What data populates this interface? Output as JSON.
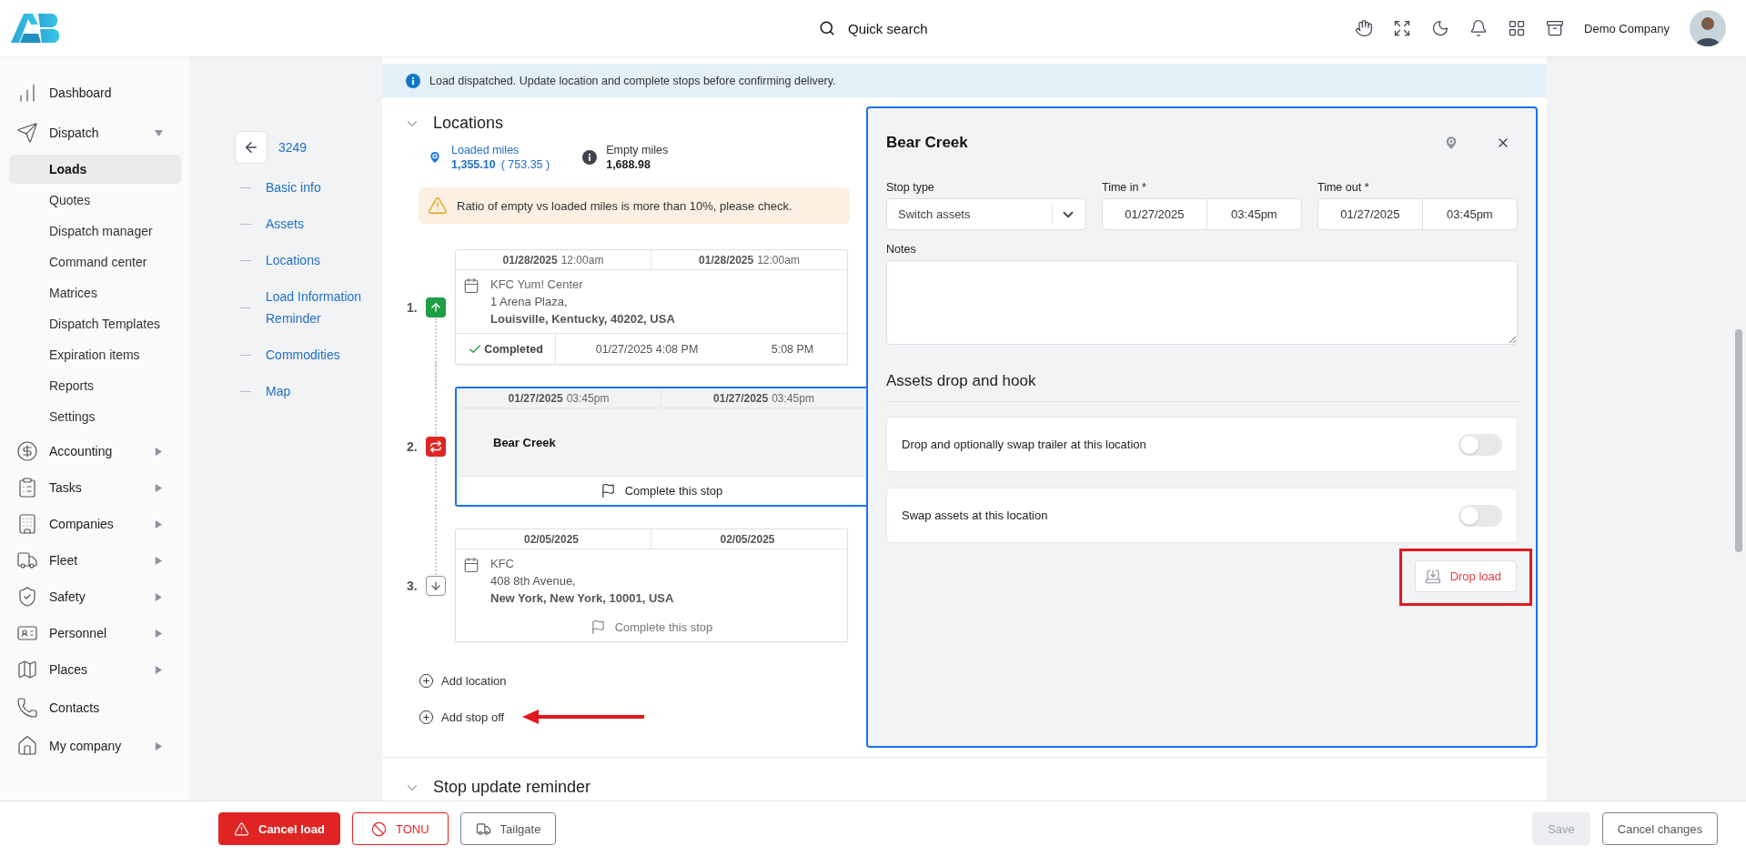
{
  "header": {
    "search_label": "Quick search",
    "company": "Demo Company"
  },
  "sidebar": {
    "items": [
      {
        "label": "Dashboard",
        "selected": false
      },
      {
        "label": "Dispatch",
        "selected": false,
        "expanded": true,
        "children": [
          {
            "label": "Loads",
            "selected": true
          },
          {
            "label": "Quotes",
            "selected": false
          },
          {
            "label": "Dispatch manager",
            "selected": false
          },
          {
            "label": "Command center",
            "selected": false
          },
          {
            "label": "Matrices",
            "selected": false
          },
          {
            "label": "Dispatch Templates",
            "selected": false
          },
          {
            "label": "Expiration items",
            "selected": false
          },
          {
            "label": "Reports",
            "selected": false
          },
          {
            "label": "Settings",
            "selected": false
          }
        ]
      },
      {
        "label": "Accounting",
        "selected": false,
        "expanded": false
      },
      {
        "label": "Tasks",
        "selected": false,
        "expanded": false
      },
      {
        "label": "Companies",
        "selected": false,
        "expanded": false
      },
      {
        "label": "Fleet",
        "selected": false,
        "expanded": false
      },
      {
        "label": "Safety",
        "selected": false,
        "expanded": false
      },
      {
        "label": "Personnel",
        "selected": false,
        "expanded": false
      },
      {
        "label": "Places",
        "selected": false,
        "expanded": false
      },
      {
        "label": "Contacts",
        "selected": false
      },
      {
        "label": "My company",
        "selected": false,
        "expanded": false
      }
    ]
  },
  "anchor_nav": {
    "load_number": "3249",
    "links": [
      {
        "label": "Basic info"
      },
      {
        "label": "Assets"
      },
      {
        "label": "Locations"
      },
      {
        "label": "Load Information Reminder"
      },
      {
        "label": "Commodities"
      },
      {
        "label": "Map"
      }
    ]
  },
  "banner": "Load dispatched. Update location and complete stops before confirming delivery.",
  "locations": {
    "title": "Locations",
    "loaded_miles": {
      "label": "Loaded miles",
      "value": "1,355.10",
      "extra": "( 753.35 )"
    },
    "empty_miles": {
      "label": "Empty miles",
      "value": "1,688.98"
    },
    "warning": "Ratio of empty vs loaded miles is more than 10%, please check.",
    "stops": [
      {
        "number": "1.",
        "kind": "pickup",
        "selected": false,
        "arrival": {
          "date": "01/28/2025",
          "time": "12:00am"
        },
        "departure": {
          "date": "01/28/2025",
          "time": "12:00am"
        },
        "name": "KFC Yum! Center",
        "street": "1 Arena Plaza,",
        "city": "Louisville, Kentucky, 40202, USA",
        "completed": true,
        "status": "Completed",
        "actual_in": "01/27/2025 4:08 PM",
        "actual_out": "5:08 PM"
      },
      {
        "number": "2.",
        "kind": "switch",
        "selected": true,
        "arrival": {
          "date": "01/27/2025",
          "time": "03:45pm"
        },
        "departure": {
          "date": "01/27/2025",
          "time": "03:45pm"
        },
        "name": "Bear Creek",
        "completed": false,
        "action": "Complete this stop"
      },
      {
        "number": "3.",
        "kind": "delivery",
        "selected": false,
        "arrival": {
          "date": "02/05/2025"
        },
        "departure": {
          "date": "02/05/2025"
        },
        "name": "KFC",
        "street": "408 8th Avenue,",
        "city": "New York, New York, 10001, USA",
        "completed": false,
        "action": "Complete this stop"
      }
    ],
    "add_location": "Add location",
    "add_stop_off": "Add stop off"
  },
  "stop_detail": {
    "title": "Bear Creek",
    "stop_type": {
      "label": "Stop type",
      "value": "Switch assets"
    },
    "time_in": {
      "label": "Time in *",
      "date": "01/27/2025",
      "time": "03:45pm"
    },
    "time_out": {
      "label": "Time out *",
      "date": "01/27/2025",
      "time": "03:45pm"
    },
    "notes_label": "Notes",
    "section_title": "Assets drop and hook",
    "toggles": [
      {
        "label": "Drop and optionally swap trailer at this location",
        "on": false
      },
      {
        "label": "Swap assets at this location",
        "on": false
      }
    ],
    "drop_load": "Drop load"
  },
  "next_section": {
    "title": "Stop update reminder"
  },
  "footer": {
    "left": [
      {
        "label": "Cancel load",
        "kind": "danger",
        "disabled": false
      },
      {
        "label": "TONU",
        "kind": "outline-danger",
        "disabled": false
      },
      {
        "label": "Tailgate",
        "kind": "outline",
        "disabled": false
      }
    ],
    "right": [
      {
        "label": "Save",
        "kind": "primary",
        "disabled": true
      },
      {
        "label": "Cancel changes",
        "kind": "outline",
        "disabled": false
      }
    ]
  }
}
